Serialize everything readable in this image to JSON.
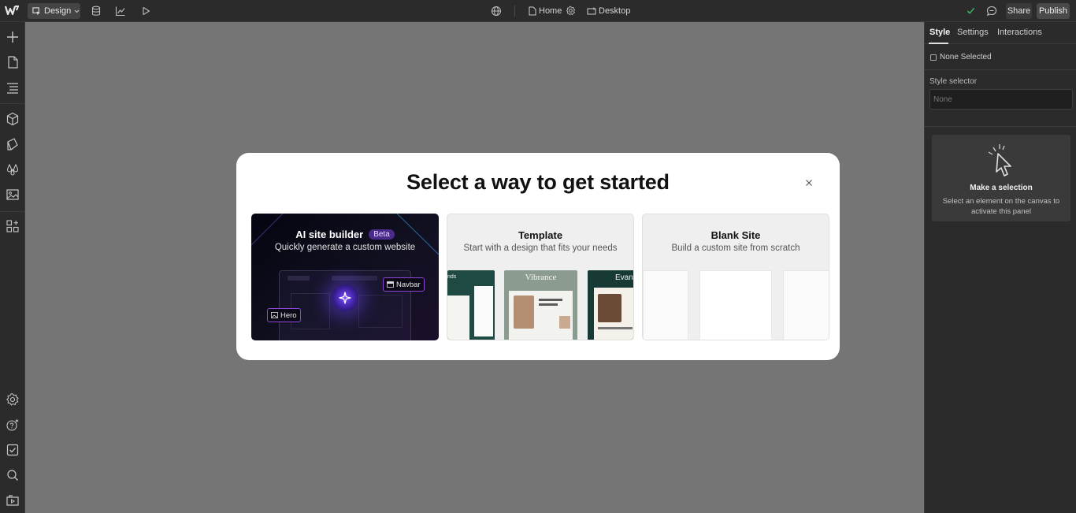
{
  "topbar": {
    "mode_label": "Design",
    "page_label": "Home",
    "breakpoint_label": "Desktop",
    "share_label": "Share",
    "publish_label": "Publish"
  },
  "right_panel": {
    "tabs": [
      "Style",
      "Settings",
      "Interactions"
    ],
    "none_selected": "None Selected",
    "style_selector_label": "Style selector",
    "style_selector_placeholder": "None",
    "card_title": "Make a selection",
    "card_desc": "Select an element on the canvas to activate this panel"
  },
  "modal": {
    "title": "Select a way to get started",
    "options": [
      {
        "title": "AI site builder",
        "badge": "Beta",
        "desc": "Quickly generate a custom website",
        "chips": [
          "Navbar",
          "Hero"
        ]
      },
      {
        "title": "Template",
        "desc": "Start with a design that fits your needs",
        "thumbs": [
          "nds",
          "Vibrance",
          "Evan"
        ]
      },
      {
        "title": "Blank Site",
        "desc": "Build a custom site from scratch"
      }
    ]
  },
  "colors": {
    "chrome": "#2b2b2b",
    "canvas": "#757575",
    "modal_bg": "#ffffff",
    "ai_accent": "#7a4dff",
    "chip_border": "#8e44d6",
    "check_green": "#3ec86b"
  }
}
